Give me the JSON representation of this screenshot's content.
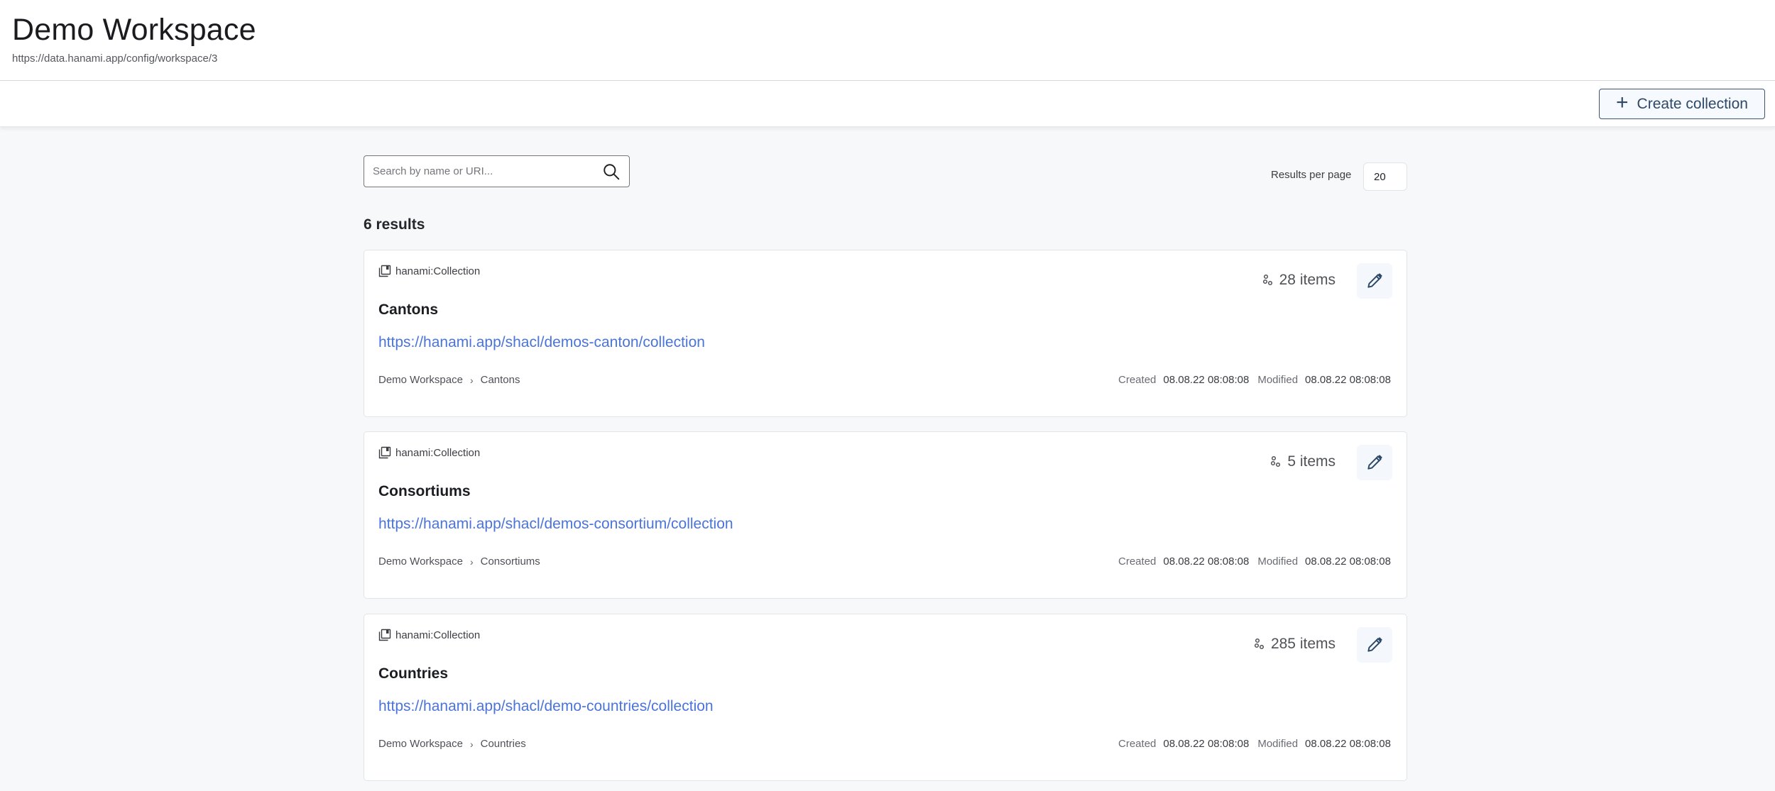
{
  "header": {
    "title": "Demo Workspace",
    "subtitle": "https://data.hanami.app/config/workspace/3"
  },
  "toolbar": {
    "create_label": "Create collection",
    "create_icon": "plus-icon"
  },
  "search": {
    "placeholder": "Search by name or URI...",
    "value": "",
    "icon": "search-icon"
  },
  "pagination": {
    "results_per_page_label": "Results per page",
    "results_per_page_value": "20"
  },
  "results": {
    "count_label": "6 results"
  },
  "colors": {
    "accent": "#2e4868",
    "link": "#4a74d9",
    "background": "#f7f8fa"
  },
  "cards": [
    {
      "type_label": "hanami:Collection",
      "title": "Cantons",
      "uri": "https://hanami.app/shacl/demos-canton/collection",
      "breadcrumb": [
        "Demo Workspace",
        "Cantons"
      ],
      "items_label": "28 items",
      "created_label": "Created",
      "created_value": "08.08.22 08:08:08",
      "modified_label": "Modified",
      "modified_value": "08.08.22 08:08:08"
    },
    {
      "type_label": "hanami:Collection",
      "title": "Consortiums",
      "uri": "https://hanami.app/shacl/demos-consortium/collection",
      "breadcrumb": [
        "Demo Workspace",
        "Consortiums"
      ],
      "items_label": "5 items",
      "created_label": "Created",
      "created_value": "08.08.22 08:08:08",
      "modified_label": "Modified",
      "modified_value": "08.08.22 08:08:08"
    },
    {
      "type_label": "hanami:Collection",
      "title": "Countries",
      "uri": "https://hanami.app/shacl/demo-countries/collection",
      "breadcrumb": [
        "Demo Workspace",
        "Countries"
      ],
      "items_label": "285 items",
      "created_label": "Created",
      "created_value": "08.08.22 08:08:08",
      "modified_label": "Modified",
      "modified_value": "08.08.22 08:08:08"
    }
  ]
}
